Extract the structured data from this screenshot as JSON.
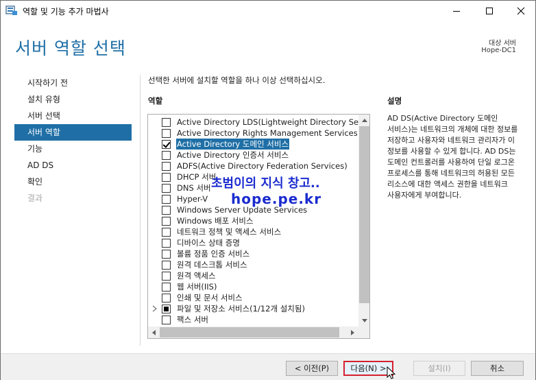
{
  "window": {
    "title": "역할 및 기능 추가 마법사"
  },
  "header": {
    "page_title": "서버 역할 선택",
    "destination_label": "대상 서버",
    "destination_value": "Hope-DC1"
  },
  "nav": {
    "items": [
      {
        "label": "시작하기 전",
        "state": "normal"
      },
      {
        "label": "설치 유형",
        "state": "normal"
      },
      {
        "label": "서버 선택",
        "state": "normal"
      },
      {
        "label": "서버 역할",
        "state": "active"
      },
      {
        "label": "기능",
        "state": "normal"
      },
      {
        "label": "AD DS",
        "state": "normal"
      },
      {
        "label": "확인",
        "state": "normal"
      },
      {
        "label": "결과",
        "state": "disabled"
      }
    ]
  },
  "main": {
    "instruction": "선택한 서버에 설치할 역할을 하나 이상 선택하십시오.",
    "roles_header": "역할",
    "description_header": "설명",
    "roles": [
      {
        "label": "Active Directory LDS(Lightweight Directory Services)",
        "state": "unchecked"
      },
      {
        "label": "Active Directory Rights Management Services",
        "state": "unchecked"
      },
      {
        "label": "Active Directory 도메인 서비스",
        "state": "checked",
        "selected": true
      },
      {
        "label": "Active Directory 인증서 서비스",
        "state": "unchecked"
      },
      {
        "label": "ADFS(Active Directory Federation Services)",
        "state": "unchecked"
      },
      {
        "label": "DHCP 서버",
        "state": "unchecked"
      },
      {
        "label": "DNS 서버",
        "state": "unchecked"
      },
      {
        "label": "Hyper-V",
        "state": "unchecked"
      },
      {
        "label": "Windows Server Update Services",
        "state": "unchecked"
      },
      {
        "label": "Windows 배포 서비스",
        "state": "unchecked"
      },
      {
        "label": "네트워크 정책 및 액세스 서비스",
        "state": "unchecked"
      },
      {
        "label": "디바이스 상태 증명",
        "state": "unchecked"
      },
      {
        "label": "볼륨 정품 인증 서비스",
        "state": "unchecked"
      },
      {
        "label": "원격 데스크톱 서비스",
        "state": "unchecked"
      },
      {
        "label": "원격 액세스",
        "state": "unchecked"
      },
      {
        "label": "웹 서버(IIS)",
        "state": "unchecked"
      },
      {
        "label": "인쇄 및 문서 서비스",
        "state": "unchecked"
      },
      {
        "label": "파일 및 저장소 서비스(1/12개 설치됨)",
        "state": "partial",
        "expandable": true
      },
      {
        "label": "팩스 서버",
        "state": "unchecked"
      }
    ],
    "description": "AD DS(Active Directory 도메인 서비스)는 네트워크의 개체에 대한 정보를 저장하고 사용자와 네트워크 관리자가 이 정보를 사용할 수 있게 합니다. AD DS는 도메인 컨트롤러를 사용하여 단일 로그온 프로세스를 통해 네트워크의 허용된 모든 리소스에 대한 액세스 권한을 네트워크 사용자에게 부여합니다."
  },
  "watermark": {
    "line1": "초범이의 지식 창고..",
    "line2": "hope.pe.kr"
  },
  "footer": {
    "prev_label": "< 이전(P)",
    "next_label": "다음(N) >",
    "install_label": "설치(I)",
    "cancel_label": "취소"
  },
  "colors": {
    "accent": "#1f6fa6",
    "watermark": "#1b2bcf",
    "highlight_border": "#d6202f"
  }
}
